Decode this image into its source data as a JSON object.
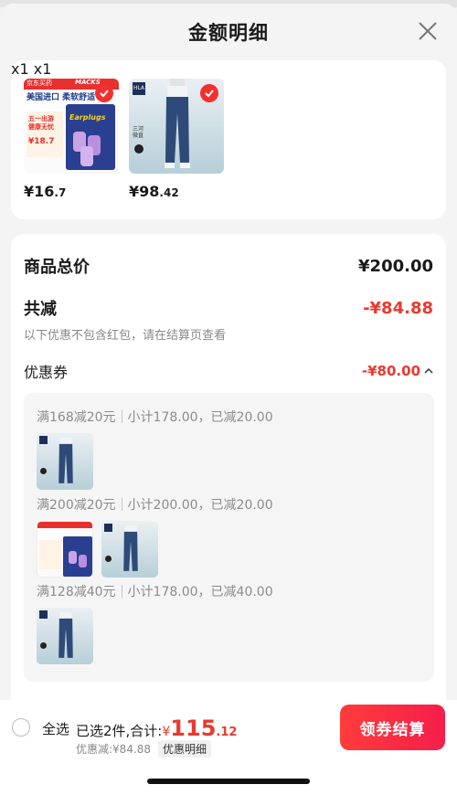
{
  "header": {
    "title": "金额明细"
  },
  "products": [
    {
      "price_int": "¥16",
      "price_dec": ".7",
      "qty": "x1",
      "badge_top": "京东买药",
      "badge_brand": "MACKS",
      "line1": "美国进口 柔软舒适",
      "promo": "五一出游 健康无忧",
      "promo_price": "¥18.7",
      "pack": "Earplugs"
    },
    {
      "price_int": "¥98",
      "price_dec": ".42",
      "qty": "x1",
      "brand": "HLA",
      "tag": "三河 微直"
    }
  ],
  "summary": {
    "total_label": "商品总价",
    "total_value": "¥200.00",
    "reduce_label": "共减",
    "reduce_value": "-¥84.88",
    "note": "以下优惠不包含红包，请在结算页查看",
    "coupon_label": "优惠券",
    "coupon_value": "-¥80.00"
  },
  "coupons": [
    {
      "rule": "满168减20元",
      "detail": "小计178.00，已减20.00"
    },
    {
      "rule": "满200减20元",
      "detail": "小计200.00，已减20.00"
    },
    {
      "rule": "满128减40元",
      "detail": "小计178.00，已减40.00"
    }
  ],
  "bottom": {
    "select_all": "全选",
    "selected_text": "已选2件,合计:",
    "currency": "¥",
    "total_int": "115",
    "total_dec": ".12",
    "discount_text": "优惠减:¥84.88",
    "detail_chip": "优惠明细",
    "checkout_button": "领券结算"
  },
  "colors": {
    "accent_red": "#e83a2f",
    "button_red": "#f51e4a"
  }
}
